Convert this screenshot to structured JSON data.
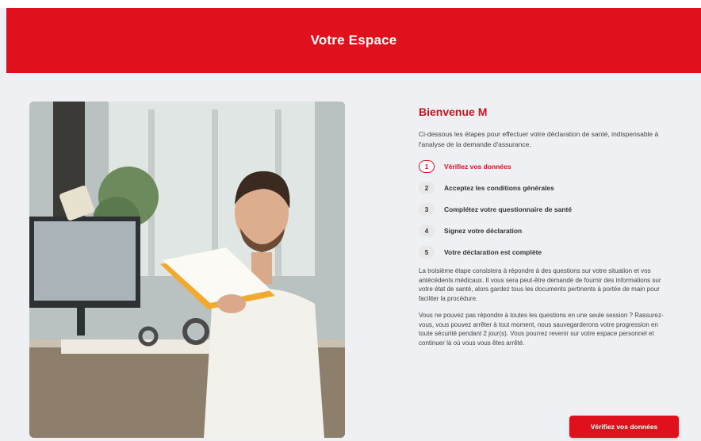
{
  "header": {
    "title": "Votre Espace"
  },
  "welcome": {
    "title": "Bienvenue M"
  },
  "intro": "Ci-dessous les étapes pour effectuer votre déclaration de santé, indispensable à l'analyse de la demande d'assurance.",
  "steps": [
    {
      "number": "1",
      "label": "Vérifiez vos données",
      "active": true
    },
    {
      "number": "2",
      "label": "Acceptez les conditions générales",
      "active": false
    },
    {
      "number": "3",
      "label": "Complétez votre questionnaire de santé",
      "active": false
    },
    {
      "number": "4",
      "label": "Signez votre déclaration",
      "active": false
    },
    {
      "number": "5",
      "label": "Votre déclaration est complète",
      "active": false
    }
  ],
  "paragraphs": {
    "p1": "La troisième étape consistera à répondre à des questions sur votre situation et vos antécédents médicaux. Il vous sera peut-être demandé de fournir des informations sur votre état de santé, alors gardez tous les documents pertinents à portée de main pour faciliter la procédure.",
    "p2": "Vous ne pouvez pas répondre à toutes les questions en une seule session ? Rassurez-vous, vous pouvez arrêter à tout moment, nous sauvegarderons votre progression en toute sécurité pendant 2 jour(s). Vous pourrez revenir sur votre espace personnel et continuer là où vous vous êtes arrêté."
  },
  "cta": {
    "label": "Vérifiez vos données"
  },
  "colors": {
    "brand": "#e0111d",
    "background": "#eef0f3"
  }
}
